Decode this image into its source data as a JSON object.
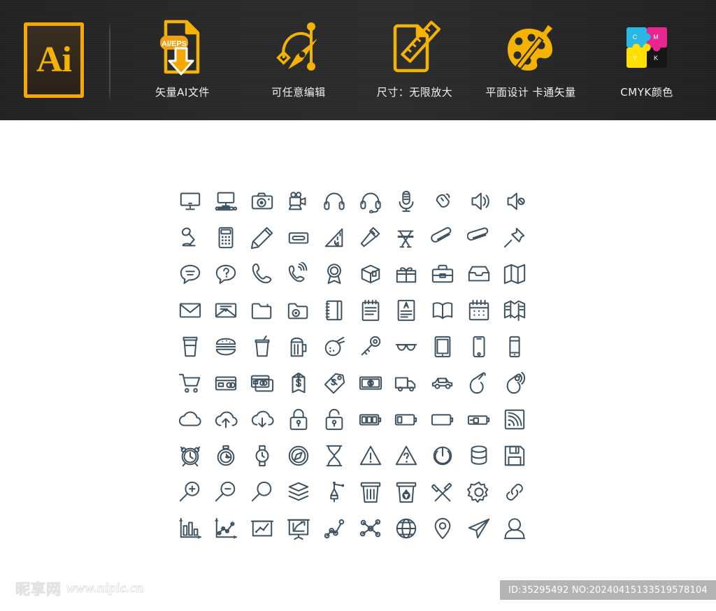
{
  "header": {
    "logo": {
      "name": "adobe-illustrator-logo",
      "text": "Ai",
      "border_color": "#F5A800",
      "fill_color": "#332719"
    },
    "features": [
      {
        "icon": "ai-eps-file-download-icon",
        "label": "矢量AI文件"
      },
      {
        "icon": "pen-tool-bezier-icon",
        "label": "可任意编辑"
      },
      {
        "icon": "document-ruler-icon",
        "label": "尺寸：无限放大"
      },
      {
        "icon": "palette-brush-icon",
        "label": "平面设计  卡通矢量"
      },
      {
        "icon": "cmyk-puzzle-icon",
        "label": "CMYK颜色"
      }
    ],
    "accent_color": "#F5B301",
    "background_color": "#2a2a2a",
    "label_color": "#F0F0F0"
  },
  "icon_grid": {
    "columns": 10,
    "rows": 10,
    "stroke_color": "#3E5160",
    "background_color": "#FFFFFF",
    "icons": [
      "monitor-icon",
      "desktop-computer-icon",
      "camera-icon",
      "film-camera-icon",
      "headphones-icon",
      "headset-icon",
      "microphone-icon",
      "mouse-icon",
      "speaker-volume-icon",
      "speaker-mute-icon",
      "desk-lamp-icon",
      "calculator-icon",
      "pencil-icon",
      "cassette-tape-icon",
      "triangle-ruler-icon",
      "hammer-icon",
      "director-chair-icon",
      "paperclip-icon",
      "paperclip-alt-icon",
      "pushpin-icon",
      "chat-bubble-icon",
      "question-bubble-icon",
      "phone-icon",
      "phone-ringing-icon",
      "award-ribbon-icon",
      "package-box-icon",
      "gift-box-icon",
      "briefcase-icon",
      "inbox-tray-icon",
      "folded-map-icon",
      "envelope-icon",
      "open-envelope-icon",
      "folder-icon",
      "photo-folder-icon",
      "spiral-notebook-icon",
      "notepad-icon",
      "document-text-icon",
      "open-book-icon",
      "calendar-icon",
      "brochure-icon",
      "coffee-cup-icon",
      "hamburger-icon",
      "soda-cup-icon",
      "beer-mug-icon",
      "food-plate-icon",
      "key-icon",
      "sunglasses-icon",
      "tablet-icon",
      "smartphone-icon",
      "mobile-phone-icon",
      "shopping-cart-icon",
      "credit-card-icon",
      "credit-cards-icon",
      "price-tag-dollar-icon",
      "sale-tag-icon",
      "banknote-icon",
      "delivery-truck-icon",
      "car-icon",
      "pointing-hand-icon",
      "tap-gesture-icon",
      "cloud-icon",
      "cloud-upload-icon",
      "cloud-download-icon",
      "lock-closed-icon",
      "lock-open-icon",
      "battery-full-icon",
      "battery-low-icon",
      "battery-empty-icon",
      "battery-charging-icon",
      "wifi-signal-icon",
      "alarm-clock-icon",
      "stopwatch-icon",
      "wristwatch-icon",
      "compass-icon",
      "hourglass-icon",
      "warning-triangle-icon",
      "question-triangle-icon",
      "power-button-icon",
      "database-icon",
      "floppy-disk-icon",
      "zoom-in-icon",
      "zoom-out-icon",
      "search-icon",
      "layers-icon",
      "fountain-pen-icon",
      "trash-bin-icon",
      "recycle-bin-icon",
      "tools-icon",
      "gear-settings-icon",
      "link-chain-icon",
      "bar-chart-icon",
      "line-chart-icon",
      "presentation-chart-icon",
      "presentation-board-icon",
      "node-graph-icon",
      "network-nodes-icon",
      "globe-icon",
      "location-pin-icon",
      "paper-plane-icon",
      "user-avatar-icon"
    ]
  },
  "footer": {
    "watermark_cn": "昵享网",
    "watermark_url": "www.nipic.cn",
    "id_badge": "ID:35295492 NO:20240415133519578104",
    "badge_bg": "#B4B4B4"
  }
}
